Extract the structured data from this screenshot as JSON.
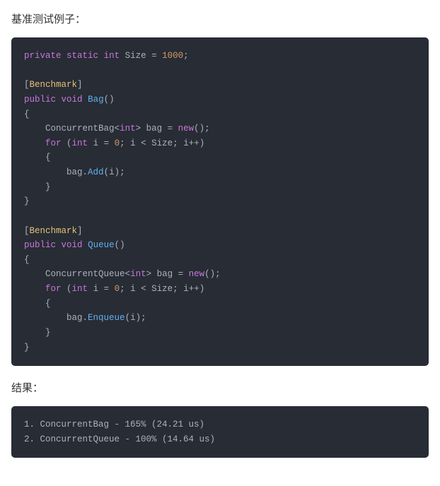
{
  "heading_example": "基准测试例子：",
  "heading_result": "结果：",
  "code1": {
    "l1": {
      "kw1": "private",
      "kw2": "static",
      "type": "int",
      "var": "Size",
      "eq": " = ",
      "num": "1000",
      "semi": ";"
    },
    "l3": {
      "lb": "[",
      "attr": "Benchmark",
      "rb": "]"
    },
    "l4": {
      "kw1": "public",
      "type": "void",
      "fn": "Bag",
      "paren": "()"
    },
    "l5": "{",
    "l6": {
      "indent": "    ",
      "cls": "ConcurrentBag",
      "lt": "<",
      "gen": "int",
      "gt": ">",
      "sp": " ",
      "var": "bag",
      "eq": " = ",
      "kw": "new",
      "tail": "();"
    },
    "l7": {
      "indent": "    ",
      "kw": "for",
      "sp": " (",
      "ty": "int",
      "sp2": " ",
      "var1": "i",
      "eq": " = ",
      "num": "0",
      "semi1": "; ",
      "var2": "i",
      "lt": " < ",
      "var3": "Size",
      "semi2": "; ",
      "var4": "i",
      "inc": "++)"
    },
    "l8": "    {",
    "l9": {
      "indent": "        ",
      "obj": "bag",
      "dot": ".",
      "fn": "Add",
      "lp": "(",
      "arg": "i",
      "rp": ");"
    },
    "l10": "    }",
    "l11": "}",
    "l13": {
      "lb": "[",
      "attr": "Benchmark",
      "rb": "]"
    },
    "l14": {
      "kw1": "public",
      "type": "void",
      "fn": "Queue",
      "paren": "()"
    },
    "l15": "{",
    "l16": {
      "indent": "    ",
      "cls": "ConcurrentQueue",
      "lt": "<",
      "gen": "int",
      "gt": ">",
      "sp": " ",
      "var": "bag",
      "eq": " = ",
      "kw": "new",
      "tail": "();"
    },
    "l17": {
      "indent": "    ",
      "kw": "for",
      "sp": " (",
      "ty": "int",
      "sp2": " ",
      "var1": "i",
      "eq": " = ",
      "num": "0",
      "semi1": "; ",
      "var2": "i",
      "lt": " < ",
      "var3": "Size",
      "semi2": "; ",
      "var4": "i",
      "inc": "++)"
    },
    "l18": "    {",
    "l19": {
      "indent": "        ",
      "obj": "bag",
      "dot": ".",
      "fn": "Enqueue",
      "lp": "(",
      "arg": "i",
      "rp": ");"
    },
    "l20": "    }",
    "l21": "}"
  },
  "code2": {
    "l1": "1. ConcurrentBag - 165% (24.21 us)",
    "l2": "2. ConcurrentQueue - 100% (14.64 us)"
  }
}
